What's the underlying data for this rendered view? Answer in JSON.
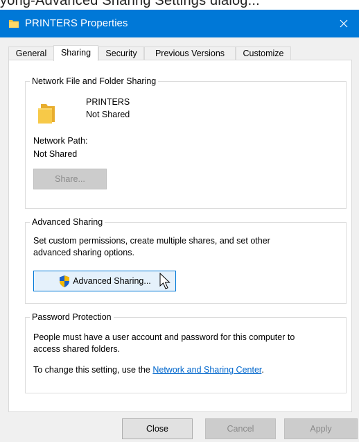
{
  "caption": {
    "text": "yong-Advanced Sharing Settings dialog..."
  },
  "window": {
    "title": "PRINTERS Properties",
    "icons": {
      "title": "folder-icon",
      "close": "close-icon"
    },
    "colors": {
      "titlebar": "#0078d7",
      "link": "#0066cc",
      "shield_blue": "#1e62c8",
      "shield_gold": "#f5b800"
    }
  },
  "tabs": [
    {
      "label": "General",
      "active": false
    },
    {
      "label": "Sharing",
      "active": true
    },
    {
      "label": "Security",
      "active": false
    },
    {
      "label": "Previous Versions",
      "active": false
    },
    {
      "label": "Customize",
      "active": false
    }
  ],
  "network_sharing": {
    "title": "Network File and Folder Sharing",
    "folder_name": "PRINTERS",
    "folder_status": "Not Shared",
    "path_label": "Network Path:",
    "path_value": "Not Shared",
    "share_button": "Share..."
  },
  "advanced_sharing": {
    "title": "Advanced Sharing",
    "description_line1": "Set custom permissions, create multiple shares, and set other",
    "description_line2": "advanced sharing options.",
    "button_label": "Advanced Sharing...",
    "button_icon": "uac-shield-icon"
  },
  "password_protection": {
    "title": "Password Protection",
    "line1": "People must have a user account and password for this computer to",
    "line2": "access shared folders.",
    "change_prefix": "To change this setting, use the ",
    "link_text": "Network and Sharing Center",
    "change_suffix": "."
  },
  "footer": {
    "close": "Close",
    "cancel": "Cancel",
    "apply": "Apply"
  }
}
